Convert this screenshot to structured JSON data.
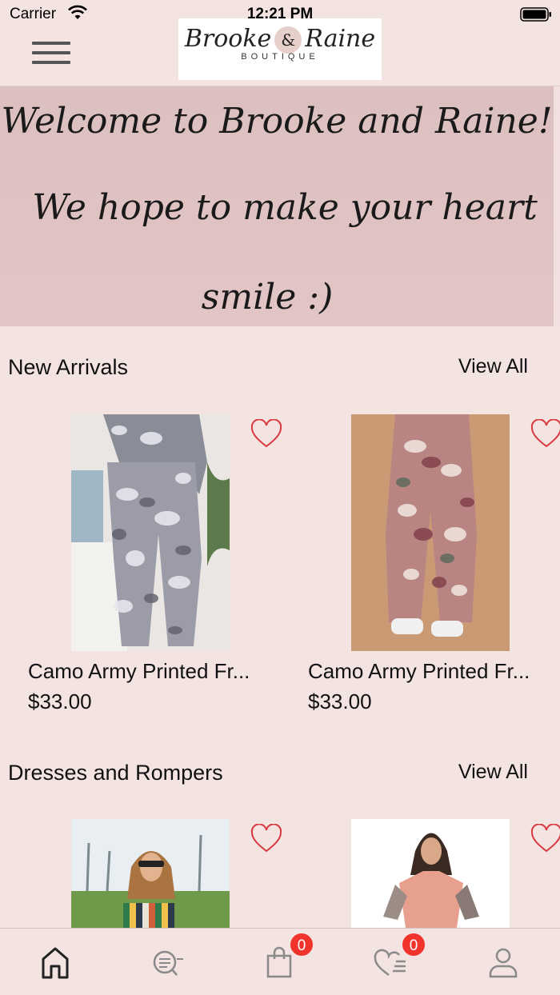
{
  "status_bar": {
    "carrier": "Carrier",
    "time": "12:21 PM",
    "icons": [
      "wifi-icon",
      "battery-icon"
    ]
  },
  "header": {
    "menu_icon": "hamburger-menu-icon",
    "logo_text": "Brooke & Raine",
    "logo_amp": "&",
    "logo_left": "Brooke",
    "logo_right": "Raine",
    "logo_subtitle": "BOUTIQUE"
  },
  "banner": {
    "line1": "Welcome to Brooke and Raine!",
    "line2": "We hope to make your heart",
    "line3": "smile :)"
  },
  "sections": [
    {
      "title": "New Arrivals",
      "view_all": "View All",
      "products": [
        {
          "name": "Camo Army Printed Fr...",
          "price": "$33.00",
          "favorite": false
        },
        {
          "name": "Camo Army Printed Fr...",
          "price": "$33.00",
          "favorite": false
        }
      ]
    },
    {
      "title": "Dresses and Rompers",
      "view_all": "View All",
      "products": [
        {
          "favorite": false
        },
        {
          "favorite": false
        }
      ]
    }
  ],
  "tab_bar": {
    "tabs": [
      {
        "icon": "home-icon",
        "selected": true
      },
      {
        "icon": "search-list-icon",
        "selected": false
      },
      {
        "icon": "shopping-bag-icon",
        "badge": "0",
        "selected": false
      },
      {
        "icon": "wishlist-icon",
        "badge": "0",
        "selected": false
      },
      {
        "icon": "profile-icon",
        "selected": false
      }
    ]
  },
  "colors": {
    "background": "#f3e3e1",
    "banner": "#dcbfbf",
    "heart": "#d9393f",
    "badge": "#f0342c"
  }
}
